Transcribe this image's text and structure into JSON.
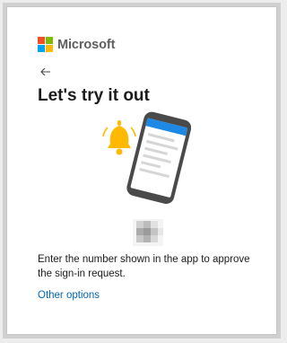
{
  "brand": {
    "name": "Microsoft",
    "logo_colors": [
      "#f25022",
      "#7fba00",
      "#00a4ef",
      "#ffb900"
    ]
  },
  "nav": {
    "back_icon": "arrow-left-icon"
  },
  "title": "Let's try it out",
  "description": "Enter the number shown in the app to approve the sign-in request.",
  "other_options_link": "Other options",
  "colors": {
    "accent": "#0067b8",
    "bell": "#ffb900",
    "phone_frame": "#4a4a4a",
    "phone_header": "#1e88e5"
  }
}
